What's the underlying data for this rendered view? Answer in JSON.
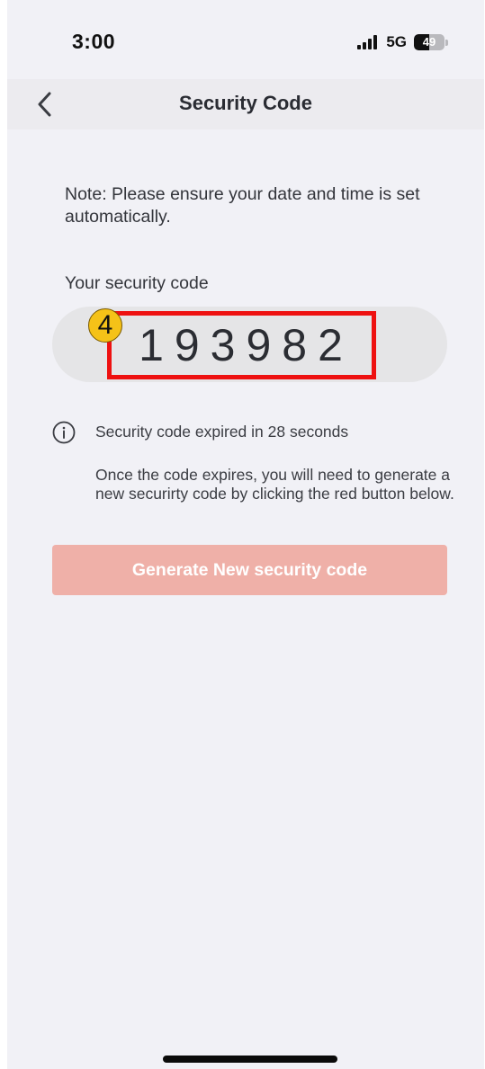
{
  "status_bar": {
    "time": "3:00",
    "network": "5G",
    "battery_level": "49",
    "battery_fraction": 0.49
  },
  "header": {
    "title": "Security Code",
    "back_icon": "chevron-left-icon"
  },
  "content": {
    "note": "Note: Please ensure your date and time is set automatically.",
    "code_label": "Your security code",
    "code": "193982",
    "step_badge": "4",
    "expiry_text": "Security code expired in 28 seconds",
    "help_text": "Once the code expires, you will need to generate a new securirty code by clicking the red button below.",
    "info_icon": "info-icon"
  },
  "actions": {
    "generate_label": "Generate New security code"
  },
  "colors": {
    "background": "#f1f1f6",
    "header": "#ecebef",
    "button_disabled": "#efb0a8",
    "highlight": "#ee1111",
    "badge": "#f5c218"
  }
}
